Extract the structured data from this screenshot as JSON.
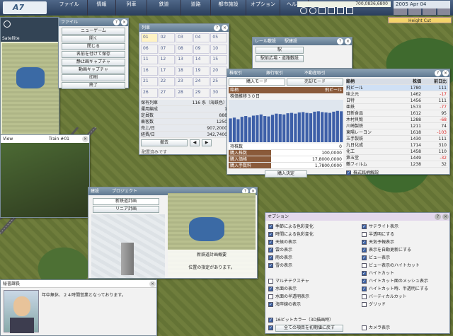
{
  "logo": "A7",
  "menu": [
    "ファイル",
    "情報",
    "列車",
    "鉄道",
    "道路",
    "都市施設",
    "オプション",
    "ヘルプ"
  ],
  "money": "700,0836,6800",
  "date": "2005 Apr 04",
  "height_cut": "Height Cut",
  "satellite": {
    "title": "Satellite"
  },
  "view": {
    "title": "View",
    "train": "Train #01"
  },
  "file_menu": {
    "title": "ファイル",
    "items": [
      "ニューゲーム",
      "開く",
      "閉じる",
      "名前を付けて保存",
      "静止画キャプチャ",
      "動画キャプチャ",
      "印刷",
      "終了"
    ]
  },
  "train_list": {
    "title": "列車",
    "cells": [
      "01",
      "02",
      "03",
      "04",
      "05",
      "06",
      "07",
      "08",
      "09",
      "10",
      "11",
      "12",
      "13",
      "14",
      "15",
      "16",
      "17",
      "18",
      "19",
      "20",
      "21",
      "22",
      "23",
      "24",
      "25",
      "26",
      "27",
      "28",
      "29",
      "30"
    ],
    "stats": [
      [
        "保有列車",
        "116 系（海鉄色）"
      ],
      [
        "運用編成",
        "1"
      ],
      [
        "定員数",
        "888"
      ],
      [
        "乗客数",
        "1250"
      ],
      [
        "売上/日",
        "907,2000"
      ],
      [
        "経費/日",
        "342,7400"
      ]
    ],
    "btn": "撤去",
    "status": "配置済みです"
  },
  "rail_window": {
    "tabs": [
      "レール敷設",
      "駅建設"
    ],
    "items": [
      "駅",
      "駅前広場・道路敷設"
    ]
  },
  "stock_window": {
    "tabs": [
      "株取引",
      "銀行取引",
      "不動産取引"
    ],
    "buy_mode": "購入モード",
    "sell_mode": "売却モード",
    "graph_label": "銘柄",
    "graph_company": "飛ビール",
    "graph_title": "株価推移３０日",
    "bars": [
      60,
      62,
      58,
      64,
      66,
      63,
      67,
      68,
      70,
      66,
      65,
      69,
      72,
      71,
      70,
      73,
      74,
      72,
      75,
      76,
      74,
      73,
      77,
      78,
      76,
      75,
      74,
      77,
      79,
      78
    ],
    "fields": [
      [
        "持株数",
        "0"
      ],
      [
        "購入株数",
        "100,0000"
      ],
      [
        "購入価格",
        "17,8000,0000"
      ],
      [
        "購入手数料",
        "1,7800,0000"
      ]
    ],
    "buy_btn": "購入決定",
    "headers": [
      "銘柄",
      "株価",
      "前日比"
    ],
    "rows": [
      [
        "飛ビール",
        "1780",
        "111"
      ],
      [
        "味之元",
        "1462",
        "-17"
      ],
      [
        "日特",
        "1456",
        "111"
      ],
      [
        "亜鉄",
        "1573",
        "-77"
      ],
      [
        "日新食品",
        "1612",
        "95"
      ],
      [
        "木村貝殻",
        "1288",
        "-68"
      ],
      [
        "川崎製鉄",
        "1211",
        "74"
      ],
      [
        "東陽レーヨン",
        "1618",
        "-103"
      ],
      [
        "玉手製鉄",
        "1430",
        "111"
      ],
      [
        "九日化成",
        "1714",
        "310"
      ],
      [
        "化工",
        "1458",
        "110"
      ],
      [
        "第五堂",
        "1449",
        "-32"
      ],
      [
        "鶴フィルム",
        "1238",
        "32"
      ]
    ],
    "footer": "株式銘柄解説"
  },
  "build_window": {
    "tabs": [
      "建設",
      "プロジェクト"
    ],
    "items": [
      "新鉄道計画",
      "リニア計画"
    ],
    "caption": "新鉄道計画概要",
    "message": "位置の指定があります。"
  },
  "secretary": {
    "title": "秘書課長",
    "message": "年中無休、２４時間営業となっております。"
  },
  "options": {
    "title": "オプション",
    "left": [
      [
        "季節による色彩変化",
        true
      ],
      [
        "時間による色彩変化",
        true
      ],
      [
        "天候の表示",
        true
      ],
      [
        "雲の表示",
        true
      ],
      [
        "雨の表示",
        true
      ],
      [
        "雪の表示",
        true
      ],
      [
        "",
        false
      ],
      [
        "マルチテクスチャ",
        false
      ],
      [
        "水面の表示",
        true
      ],
      [
        "水面の半透明表示",
        false
      ],
      [
        "海岸線の表示",
        true
      ],
      [
        "",
        false
      ],
      [
        "16ビットカラー（3D描画時）",
        true
      ],
      [
        "画面情報を縮写する",
        true
      ]
    ],
    "right": [
      [
        "サテライト表示",
        true
      ],
      [
        "半透明にする",
        false
      ],
      [
        "天気予報表示",
        true
      ],
      [
        "表示を自動更新にする",
        true
      ],
      [
        "ビュー表示",
        true
      ],
      [
        "ビュー表示のハイトカット",
        false
      ],
      [
        "ハイトカット",
        true
      ],
      [
        "ハイトカット面のメッシュ表示",
        true
      ],
      [
        "ハイトカット時、半透明にする",
        true
      ],
      [
        "バーティカルカット",
        false
      ],
      [
        "グリッド",
        false
      ],
      [
        "",
        false
      ],
      [
        "",
        false
      ],
      [
        "カメラ表示",
        false
      ]
    ],
    "reset": "全ての項目を初期値に戻す"
  }
}
